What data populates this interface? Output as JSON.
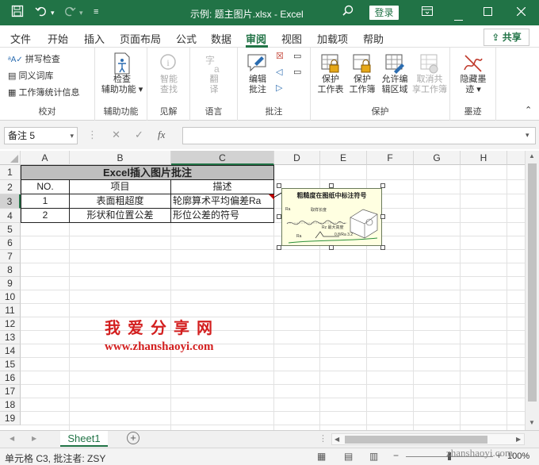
{
  "titlebar": {
    "title": "示例: 题主图片.xlsx  -  Excel",
    "login": "登录"
  },
  "menu": {
    "tabs": [
      "文件",
      "开始",
      "插入",
      "页面布局",
      "公式",
      "数据",
      "审阅",
      "视图",
      "加载项",
      "帮助"
    ],
    "active": "审阅",
    "share": "共享"
  },
  "ribbon": {
    "proofing": {
      "spell": "拼写检查",
      "thesaurus": "同义词库",
      "stats": "工作簿统计信息",
      "label": "校对"
    },
    "accessibility": {
      "check_line1": "检查",
      "check_line2": "辅助功能",
      "label": "辅助功能"
    },
    "insights": {
      "smart_line1": "智能",
      "smart_line2": "查找",
      "label": "见解"
    },
    "language": {
      "translate_line1": "翻",
      "translate_line2": "译",
      "label": "语言"
    },
    "comments": {
      "edit_line1": "编辑",
      "edit_line2": "批注",
      "label": "批注"
    },
    "protect": {
      "protect_sheet_1": "保护",
      "protect_sheet_2": "工作表",
      "protect_book_1": "保护",
      "protect_book_2": "工作簿",
      "allow_edit_1": "允许编",
      "allow_edit_2": "辑区域",
      "unshare_1": "取消共",
      "unshare_2": "享工作簿",
      "label": "保护"
    },
    "ink": {
      "hide_1": "隐藏墨",
      "hide_2": "迹",
      "label": "墨迹"
    }
  },
  "formula_bar": {
    "name_box": "备注 5",
    "cancel": "✕",
    "enter": "✓",
    "fx": "fx",
    "content": ""
  },
  "grid": {
    "columns": [
      "A",
      "B",
      "C",
      "D",
      "E",
      "F",
      "G",
      "H"
    ],
    "rows": [
      "1",
      "2",
      "3",
      "4",
      "5",
      "6",
      "7",
      "8",
      "9",
      "10",
      "11",
      "12",
      "13",
      "14",
      "15",
      "16",
      "17",
      "18",
      "19"
    ],
    "title_cell": "Excel插入图片批注",
    "headers": [
      "NO.",
      "项目",
      "描述"
    ],
    "data": [
      [
        "1",
        "表面粗超度",
        "轮廓算术平均偏差Ra"
      ],
      [
        "2",
        "形状和位置公差",
        "形位公差的符号"
      ]
    ]
  },
  "comment": {
    "heading": "粗糙度在图纸中标注符号",
    "labels": [
      "Ra",
      "取样长度",
      "Rz 最大高度",
      "0.8/Ra 3.2",
      "Ra"
    ]
  },
  "watermark": {
    "line1": "我爱分享网",
    "line2": "www.zhanshaoyi.com",
    "corner": "zhanshaoyi.com"
  },
  "sheetbar": {
    "sheet": "Sheet1",
    "add": "+"
  },
  "status": {
    "text": "单元格 C3, 批注者: ZSY",
    "zoom": "100%"
  },
  "colors": {
    "excel_green": "#217346",
    "header_fill": "#bfbfbf",
    "watermark_red": "#d31f1f",
    "comment_bg": "#ffffe1"
  }
}
